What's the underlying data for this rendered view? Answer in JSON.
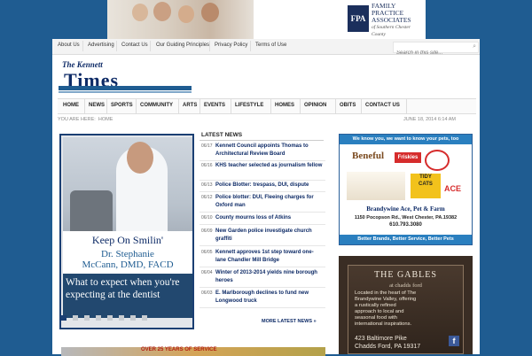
{
  "top_ad": {
    "logo_abbr": "FPA",
    "line1": "FAMILY",
    "line2": "PRACTICE",
    "line3": "ASSOCIATES",
    "line4": "of Southern Chester County"
  },
  "top_nav": {
    "links": [
      "About Us",
      "Advertising",
      "Contact Us",
      "Our Guiding Principles",
      "Privacy Policy",
      "Terms of Use"
    ],
    "search_placeholder": "Search in this site..."
  },
  "logo": {
    "line1": "The Kennett",
    "line2": "Times"
  },
  "main_nav": {
    "items": [
      "HOME",
      "NEWS",
      "SPORTS",
      "COMMUNITY",
      "ARTS",
      "EVENTS",
      "LIFESTYLE",
      "HOMES",
      "OPINION",
      "OBITS",
      "CONTACT US"
    ]
  },
  "breadcrumb": {
    "prefix": "YOU ARE HERE:",
    "current": "HOME"
  },
  "datetime": "JUNE 18, 2014 6:14 AM",
  "slider": {
    "banner_title": "Keep On Smilin'",
    "banner_sub_1": "Dr. Stephanie",
    "banner_sub_2": "McCann, DMD, FACD",
    "caption": "What to expect when you're expecting at the dentist",
    "dots": 8,
    "active_dot": 1
  },
  "latest_news": {
    "title": "LATEST NEWS",
    "items": [
      {
        "date": "06/17",
        "title": "Kennett Council appoints Thomas to Architectural Review Board"
      },
      {
        "date": "06/16",
        "title": "KHS teacher selected as journalism fellow"
      },
      {
        "date": "06/13",
        "title": "Police Blotter: trespass, DUI, dispute"
      },
      {
        "date": "06/12",
        "title": "Police blotter: DUI, Fleeing charges for Oxford man"
      },
      {
        "date": "06/10",
        "title": "County mourns loss of Atkins"
      },
      {
        "date": "06/09",
        "title": "New Garden police investigate church graffiti"
      },
      {
        "date": "06/05",
        "title": "Kennett approves 1st step toward one-lane Chandler Mill Bridge"
      },
      {
        "date": "06/04",
        "title": "Winter of 2013-2014 yields nine borough heroes"
      },
      {
        "date": "06/03",
        "title": "E. Marlborough declines to fund new Longwood truck"
      }
    ],
    "more": "MORE LATEST NEWS »"
  },
  "ad_pet": {
    "top": "We know you, we want to know your pets, too",
    "brand1": "Beneful",
    "brand2": "Friskies",
    "brand3_line1": "TIDY",
    "brand3_line2": "CATS",
    "brand4": "ACE",
    "store": "Brandywine Ace, Pet & Farm",
    "address": "1150 Pocopson Rd., West Chester, PA.19382",
    "phone": "610.793.3080",
    "bottom": "Better Brands, Better Service, Better Pets"
  },
  "ad_gables": {
    "name": "THE GABLES",
    "location": "at chadds ford",
    "desc": "Located in the heart of The Brandywine Valley, offering a rustically refined approach to local and seasonal food with international inspirations.",
    "address1": "423 Baltimore Pike",
    "address2": "Chadds Ford, PA 19317"
  },
  "bottom_ad": {
    "text": "OVER 25 YEARS OF SERVICE"
  }
}
